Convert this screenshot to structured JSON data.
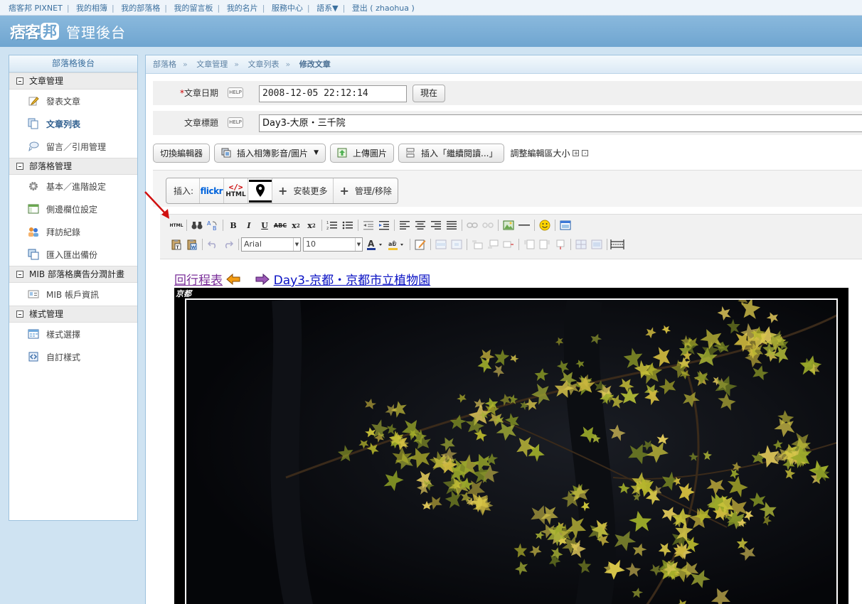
{
  "topnav": {
    "items": [
      "痞客邦 PIXNET",
      "我的相簿",
      "我的部落格",
      "我的留言板",
      "我的名片",
      "服務中心",
      "語系▼",
      "登出 ( zhaohua )"
    ]
  },
  "header": {
    "logo_main": "痞客",
    "logo_bubble": "邦",
    "title": "管理後台"
  },
  "sidebar": {
    "title": "部落格後台",
    "groups": [
      {
        "label": "文章管理",
        "items": [
          "發表文章",
          "文章列表",
          "留言／引用管理"
        ]
      },
      {
        "label": "部落格管理",
        "items": [
          "基本／進階設定",
          "側邊欄位設定",
          "拜訪紀錄",
          "匯入匯出備份"
        ]
      },
      {
        "label": "MIB 部落格廣告分潤計畫",
        "items": [
          "MIB 帳戶資訊"
        ]
      },
      {
        "label": "樣式管理",
        "items": [
          "樣式選擇",
          "自訂樣式"
        ]
      }
    ]
  },
  "breadcrumb": {
    "items": [
      "部落格",
      "文章管理",
      "文章列表"
    ],
    "current": "修改文章"
  },
  "form": {
    "date_label": "文章日期",
    "date_required_mark": "*",
    "help_text": "HELP",
    "date_value": "2008-12-05 22:12:14",
    "now_label": "現在",
    "title_label": "文章標題",
    "title_value": "Day3-大原・三千院"
  },
  "editor_buttons": {
    "switch_editor": "切換編輯器",
    "insert_media": "插入相簿影音/圖片",
    "upload_image": "上傳圖片",
    "insert_more": "插入「繼續閱讀...」",
    "resize_label": "調整編輯區大小",
    "plus": "+",
    "minus": "-"
  },
  "insert_bar": {
    "label": "插入:",
    "flickr": "flickr",
    "html_tag": "</>",
    "html": "HTML",
    "install_more": "安裝更多",
    "manage": "管理/移除"
  },
  "toolbar": {
    "html_icon": "HTML",
    "abc": "ABC",
    "font_name": "Arial",
    "font_size": "10"
  },
  "content": {
    "back_link": "回行程表",
    "next_link": "Day3-京都・京都市立植物園",
    "photo_label": "京都"
  },
  "colors": {
    "accent": "#6fa5d0",
    "link_visited": "#7a2f99",
    "link": "#0a12c4",
    "required": "#cc0000"
  }
}
